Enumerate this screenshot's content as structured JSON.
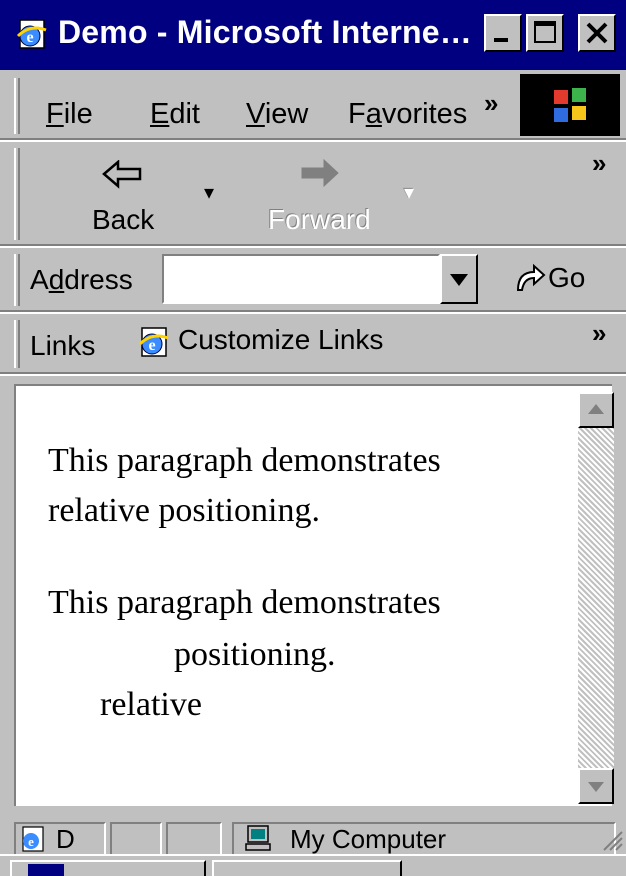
{
  "window": {
    "title": "Demo - Microsoft Interne…",
    "minimize_icon": "minimize-icon",
    "maximize_icon": "maximize-icon",
    "close_icon": "close-icon"
  },
  "menu": {
    "items": [
      {
        "label": "File",
        "accel": "F"
      },
      {
        "label": "Edit",
        "accel": "E"
      },
      {
        "label": "View",
        "accel": "V"
      },
      {
        "label": "Favorites",
        "accel": "a"
      }
    ],
    "more": "»"
  },
  "toolbar": {
    "back_label": "Back",
    "forward_label": "Forward",
    "more": "»"
  },
  "address": {
    "label": "Address",
    "value": "",
    "go_label": "Go"
  },
  "links": {
    "label": "Links",
    "customize_label": "Customize Links",
    "more": "»"
  },
  "content": {
    "para1_line1": "This paragraph demonstrates",
    "para1_line2": "relative positioning.",
    "para2_line1": "This paragraph demonstrates",
    "para2_line2": "positioning.",
    "para2_relative": "relative"
  },
  "statusbar": {
    "pane1": "D",
    "zone": "My Computer"
  },
  "colors": {
    "titlebar": "#000080",
    "face": "#c0c0c0",
    "content_bg": "#ffffff"
  }
}
